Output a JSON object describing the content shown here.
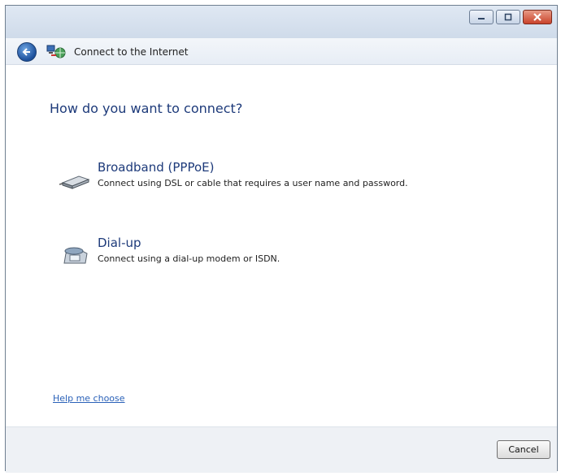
{
  "window": {
    "title": "Connect to the Internet"
  },
  "caption_buttons": {
    "minimize_icon": "minimize-icon",
    "maximize_icon": "maximize-icon",
    "close_icon": "close-icon"
  },
  "nav": {
    "back_icon": "back-arrow-icon",
    "app_icon": "network-connection-icon",
    "title": "Connect to the Internet"
  },
  "page": {
    "heading": "How do you want to connect?"
  },
  "options": [
    {
      "title": "Broadband (PPPoE)",
      "description": "Connect using DSL or cable that requires a user name and password.",
      "icon": "broadband-modem-icon"
    },
    {
      "title": "Dial-up",
      "description": "Connect using a dial-up modem or ISDN.",
      "icon": "dialup-phone-icon"
    }
  ],
  "help_link": "Help me choose",
  "footer": {
    "cancel_label": "Cancel"
  },
  "colors": {
    "heading": "#1d3a7a",
    "link": "#2a61b8",
    "close": "#c9432b"
  }
}
